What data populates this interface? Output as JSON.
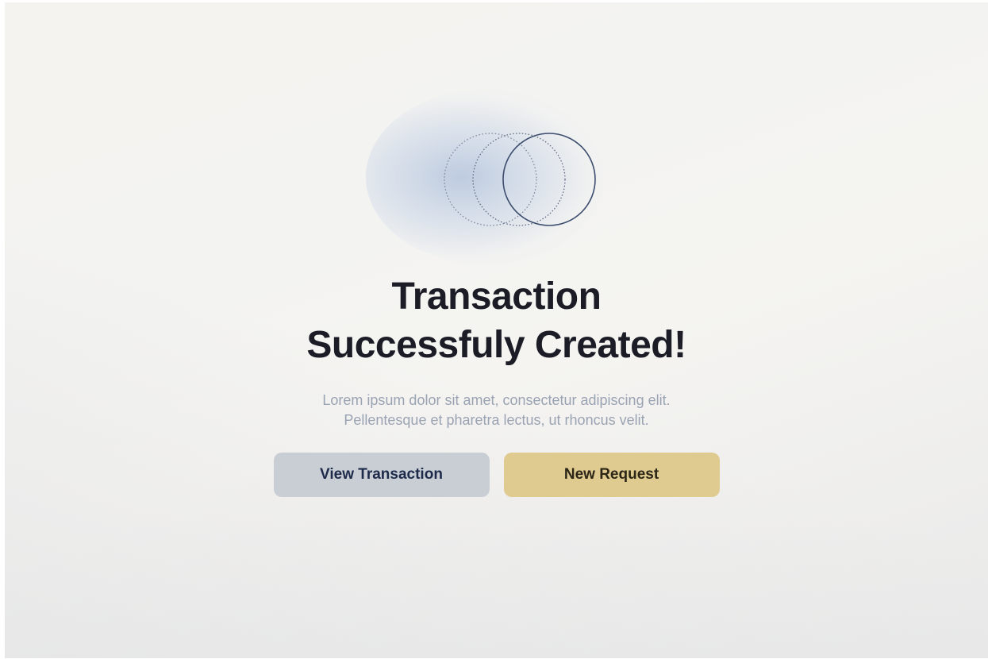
{
  "success": {
    "title_line1": "Transaction",
    "title_line2": "Successfuly Created!",
    "description_line1": "Lorem ipsum dolor sit amet, consectetur adipiscing elit.",
    "description_line2": "Pellentesque et pharetra lectus, ut rhoncus velit."
  },
  "actions": {
    "view_label": "View Transaction",
    "new_label": "New Request"
  },
  "icons": {
    "illustration": "overlapping-circles-icon"
  },
  "colors": {
    "title": "#1b1c26",
    "description": "#9aa3b3",
    "secondary_button": "#c9ced5",
    "secondary_button_text": "#1d2a4a",
    "primary_button": "#dfca90",
    "primary_button_text": "#2c2616",
    "ring_stroke": "#3c4d6e"
  }
}
